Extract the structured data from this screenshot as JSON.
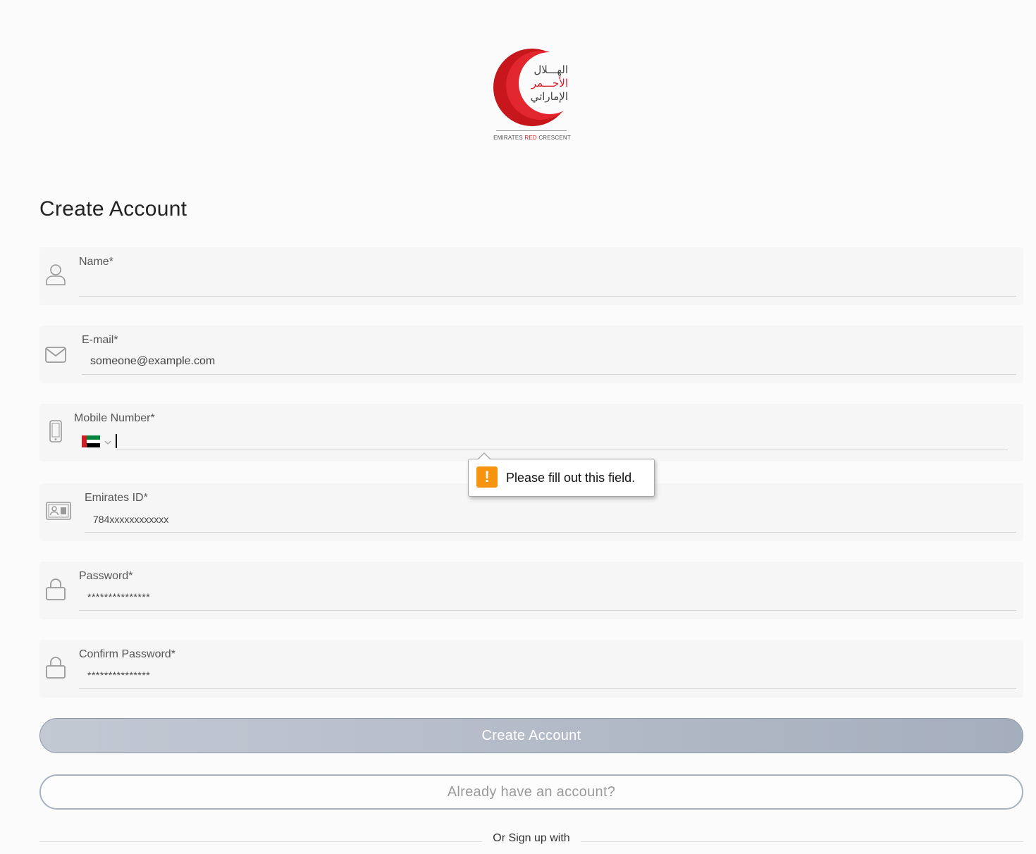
{
  "logo": {
    "arabic_line1": "الهـــلال",
    "arabic_line2": "الأحـــمر",
    "arabic_line3": "الإماراتي",
    "caption_part1": "EMIRATES ",
    "caption_red": "RED",
    "caption_part2": " CRESCENT",
    "brand_red": "#d61f26"
  },
  "page": {
    "title": "Create Account"
  },
  "form": {
    "name": {
      "label": "Name*",
      "value": "",
      "icon": "user-icon"
    },
    "email": {
      "label": "E-mail*",
      "value": "someone@example.com",
      "icon": "envelope-icon"
    },
    "mobile": {
      "label": "Mobile Number*",
      "value": "",
      "country": "AE",
      "icon": "mobile-phone-icon"
    },
    "emirates_id": {
      "label": "Emirates ID*",
      "value": "784xxxxxxxxxxxx",
      "icon": "id-card-icon"
    },
    "password": {
      "label": "Password*",
      "value": "***************",
      "icon": "lock-icon"
    },
    "confirm_password": {
      "label": "Confirm Password*",
      "value": "***************",
      "icon": "lock-icon"
    }
  },
  "validation": {
    "message": "Please fill out this field.",
    "icon": "warning-icon",
    "color": "#f7940f"
  },
  "actions": {
    "create_account": "Create Account",
    "already_have_account": "Already have an account?",
    "or_sign_up_with": "Or Sign up with"
  }
}
